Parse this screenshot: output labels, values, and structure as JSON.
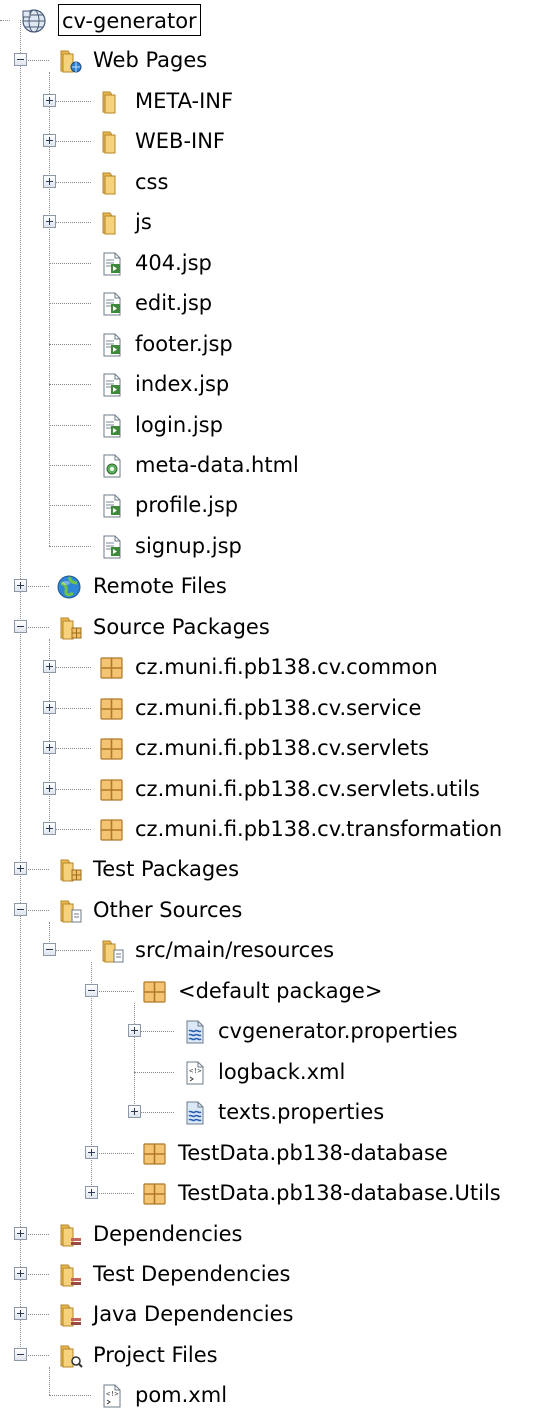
{
  "tree": {
    "nodes": [
      {
        "label": "cv-generator",
        "icon": "web-project-icon",
        "expanded": true
      },
      {
        "label": "Web Pages",
        "icon": "web-pages-folder-icon",
        "expanded": true
      },
      {
        "label": "META-INF",
        "icon": "folder-icon",
        "expanded": false
      },
      {
        "label": "WEB-INF",
        "icon": "folder-icon",
        "expanded": false
      },
      {
        "label": "css",
        "icon": "folder-icon",
        "expanded": false
      },
      {
        "label": "js",
        "icon": "folder-icon",
        "expanded": false
      },
      {
        "label": "404.jsp",
        "icon": "jsp-file-icon"
      },
      {
        "label": "edit.jsp",
        "icon": "jsp-file-icon"
      },
      {
        "label": "footer.jsp",
        "icon": "jsp-file-icon"
      },
      {
        "label": "index.jsp",
        "icon": "jsp-file-icon"
      },
      {
        "label": "login.jsp",
        "icon": "jsp-file-icon"
      },
      {
        "label": "meta-data.html",
        "icon": "html-file-icon"
      },
      {
        "label": "profile.jsp",
        "icon": "jsp-file-icon"
      },
      {
        "label": "signup.jsp",
        "icon": "jsp-file-icon"
      },
      {
        "label": "Remote Files",
        "icon": "globe-icon",
        "expanded": false
      },
      {
        "label": "Source Packages",
        "icon": "source-packages-folder-icon",
        "expanded": true
      },
      {
        "label": "cz.muni.fi.pb138.cv.common",
        "icon": "package-icon",
        "expanded": false
      },
      {
        "label": "cz.muni.fi.pb138.cv.service",
        "icon": "package-icon",
        "expanded": false
      },
      {
        "label": "cz.muni.fi.pb138.cv.servlets",
        "icon": "package-icon",
        "expanded": false
      },
      {
        "label": "cz.muni.fi.pb138.cv.servlets.utils",
        "icon": "package-icon",
        "expanded": false
      },
      {
        "label": "cz.muni.fi.pb138.cv.transformation",
        "icon": "package-icon",
        "expanded": false
      },
      {
        "label": "Test Packages",
        "icon": "test-packages-folder-icon",
        "expanded": false
      },
      {
        "label": "Other Sources",
        "icon": "other-sources-folder-icon",
        "expanded": true
      },
      {
        "label": "src/main/resources",
        "icon": "resources-folder-icon",
        "expanded": true
      },
      {
        "label": "<default package>",
        "icon": "package-icon",
        "expanded": true
      },
      {
        "label": "cvgenerator.properties",
        "icon": "properties-file-icon",
        "expanded": false
      },
      {
        "label": "logback.xml",
        "icon": "xml-file-icon"
      },
      {
        "label": "texts.properties",
        "icon": "properties-file-icon",
        "expanded": false
      },
      {
        "label": "TestData.pb138-database",
        "icon": "package-icon",
        "expanded": false
      },
      {
        "label": "TestData.pb138-database.Utils",
        "icon": "package-icon",
        "expanded": false
      },
      {
        "label": "Dependencies",
        "icon": "dependencies-folder-icon",
        "expanded": false
      },
      {
        "label": "Test Dependencies",
        "icon": "dependencies-folder-icon",
        "expanded": false
      },
      {
        "label": "Java Dependencies",
        "icon": "dependencies-folder-icon",
        "expanded": false
      },
      {
        "label": "Project Files",
        "icon": "project-files-folder-icon",
        "expanded": true
      },
      {
        "label": "pom.xml",
        "icon": "xml-file-icon"
      }
    ]
  }
}
